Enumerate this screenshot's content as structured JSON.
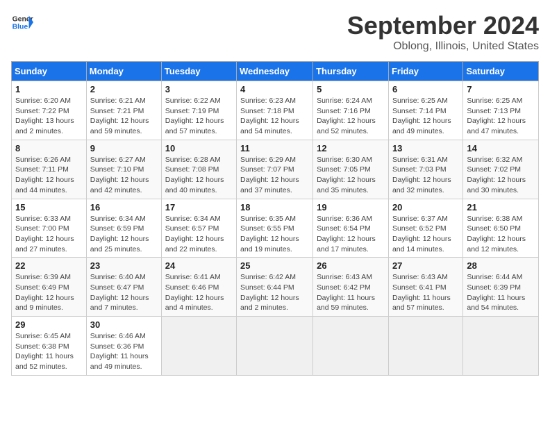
{
  "header": {
    "logo_line1": "General",
    "logo_line2": "Blue",
    "title": "September 2024",
    "subtitle": "Oblong, Illinois, United States"
  },
  "days_of_week": [
    "Sunday",
    "Monday",
    "Tuesday",
    "Wednesday",
    "Thursday",
    "Friday",
    "Saturday"
  ],
  "weeks": [
    [
      {
        "day": "1",
        "info": "Sunrise: 6:20 AM\nSunset: 7:22 PM\nDaylight: 13 hours and 2 minutes."
      },
      {
        "day": "2",
        "info": "Sunrise: 6:21 AM\nSunset: 7:21 PM\nDaylight: 12 hours and 59 minutes."
      },
      {
        "day": "3",
        "info": "Sunrise: 6:22 AM\nSunset: 7:19 PM\nDaylight: 12 hours and 57 minutes."
      },
      {
        "day": "4",
        "info": "Sunrise: 6:23 AM\nSunset: 7:18 PM\nDaylight: 12 hours and 54 minutes."
      },
      {
        "day": "5",
        "info": "Sunrise: 6:24 AM\nSunset: 7:16 PM\nDaylight: 12 hours and 52 minutes."
      },
      {
        "day": "6",
        "info": "Sunrise: 6:25 AM\nSunset: 7:14 PM\nDaylight: 12 hours and 49 minutes."
      },
      {
        "day": "7",
        "info": "Sunrise: 6:25 AM\nSunset: 7:13 PM\nDaylight: 12 hours and 47 minutes."
      }
    ],
    [
      {
        "day": "8",
        "info": "Sunrise: 6:26 AM\nSunset: 7:11 PM\nDaylight: 12 hours and 44 minutes."
      },
      {
        "day": "9",
        "info": "Sunrise: 6:27 AM\nSunset: 7:10 PM\nDaylight: 12 hours and 42 minutes."
      },
      {
        "day": "10",
        "info": "Sunrise: 6:28 AM\nSunset: 7:08 PM\nDaylight: 12 hours and 40 minutes."
      },
      {
        "day": "11",
        "info": "Sunrise: 6:29 AM\nSunset: 7:07 PM\nDaylight: 12 hours and 37 minutes."
      },
      {
        "day": "12",
        "info": "Sunrise: 6:30 AM\nSunset: 7:05 PM\nDaylight: 12 hours and 35 minutes."
      },
      {
        "day": "13",
        "info": "Sunrise: 6:31 AM\nSunset: 7:03 PM\nDaylight: 12 hours and 32 minutes."
      },
      {
        "day": "14",
        "info": "Sunrise: 6:32 AM\nSunset: 7:02 PM\nDaylight: 12 hours and 30 minutes."
      }
    ],
    [
      {
        "day": "15",
        "info": "Sunrise: 6:33 AM\nSunset: 7:00 PM\nDaylight: 12 hours and 27 minutes."
      },
      {
        "day": "16",
        "info": "Sunrise: 6:34 AM\nSunset: 6:59 PM\nDaylight: 12 hours and 25 minutes."
      },
      {
        "day": "17",
        "info": "Sunrise: 6:34 AM\nSunset: 6:57 PM\nDaylight: 12 hours and 22 minutes."
      },
      {
        "day": "18",
        "info": "Sunrise: 6:35 AM\nSunset: 6:55 PM\nDaylight: 12 hours and 19 minutes."
      },
      {
        "day": "19",
        "info": "Sunrise: 6:36 AM\nSunset: 6:54 PM\nDaylight: 12 hours and 17 minutes."
      },
      {
        "day": "20",
        "info": "Sunrise: 6:37 AM\nSunset: 6:52 PM\nDaylight: 12 hours and 14 minutes."
      },
      {
        "day": "21",
        "info": "Sunrise: 6:38 AM\nSunset: 6:50 PM\nDaylight: 12 hours and 12 minutes."
      }
    ],
    [
      {
        "day": "22",
        "info": "Sunrise: 6:39 AM\nSunset: 6:49 PM\nDaylight: 12 hours and 9 minutes."
      },
      {
        "day": "23",
        "info": "Sunrise: 6:40 AM\nSunset: 6:47 PM\nDaylight: 12 hours and 7 minutes."
      },
      {
        "day": "24",
        "info": "Sunrise: 6:41 AM\nSunset: 6:46 PM\nDaylight: 12 hours and 4 minutes."
      },
      {
        "day": "25",
        "info": "Sunrise: 6:42 AM\nSunset: 6:44 PM\nDaylight: 12 hours and 2 minutes."
      },
      {
        "day": "26",
        "info": "Sunrise: 6:43 AM\nSunset: 6:42 PM\nDaylight: 11 hours and 59 minutes."
      },
      {
        "day": "27",
        "info": "Sunrise: 6:43 AM\nSunset: 6:41 PM\nDaylight: 11 hours and 57 minutes."
      },
      {
        "day": "28",
        "info": "Sunrise: 6:44 AM\nSunset: 6:39 PM\nDaylight: 11 hours and 54 minutes."
      }
    ],
    [
      {
        "day": "29",
        "info": "Sunrise: 6:45 AM\nSunset: 6:38 PM\nDaylight: 11 hours and 52 minutes."
      },
      {
        "day": "30",
        "info": "Sunrise: 6:46 AM\nSunset: 6:36 PM\nDaylight: 11 hours and 49 minutes."
      },
      {
        "day": "",
        "info": ""
      },
      {
        "day": "",
        "info": ""
      },
      {
        "day": "",
        "info": ""
      },
      {
        "day": "",
        "info": ""
      },
      {
        "day": "",
        "info": ""
      }
    ]
  ]
}
